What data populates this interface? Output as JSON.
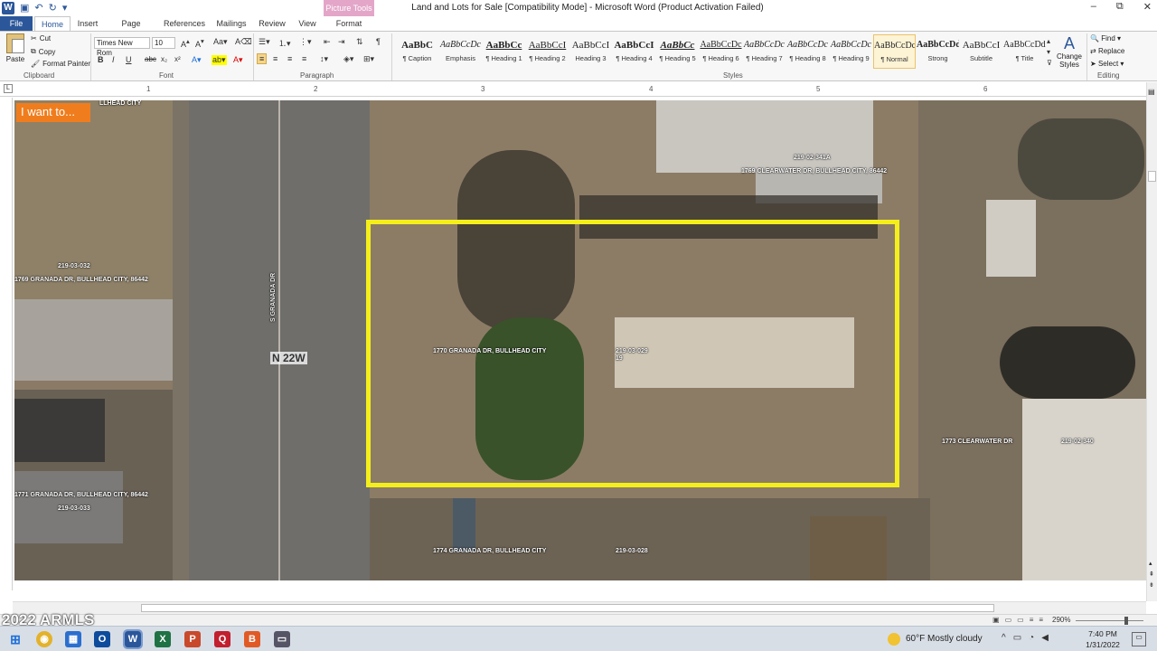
{
  "window": {
    "title": "Land and Lots for Sale [Compatibility Mode] - Microsoft Word (Product Activation Failed)",
    "picture_tools": "Picture Tools",
    "controls": [
      "–",
      "⧉",
      "✕"
    ]
  },
  "tabs": [
    "File",
    "Home",
    "Insert",
    "Page Layout",
    "References",
    "Mailings",
    "Review",
    "View",
    "Format"
  ],
  "clipboard": {
    "paste": "Paste",
    "cut": "Cut",
    "copy": "Copy",
    "format_painter": "Format Painter",
    "label": "Clipboard"
  },
  "font": {
    "name": "Times New Rom",
    "size": "10",
    "label": "Font",
    "buttons": [
      "B",
      "I",
      "U",
      "abc",
      "x₂",
      "x²"
    ]
  },
  "paragraph": {
    "label": "Paragraph"
  },
  "styles": {
    "label": "Styles",
    "items": [
      {
        "sample": "AaBbC",
        "name": "¶ Caption"
      },
      {
        "sample": "AaBbCcDc",
        "name": "Emphasis"
      },
      {
        "sample": "AaBbCc",
        "name": "¶ Heading 1"
      },
      {
        "sample": "AaBbCcI",
        "name": "¶ Heading 2"
      },
      {
        "sample": "AaBbCcI",
        "name": "Heading 3"
      },
      {
        "sample": "AaBbCcI",
        "name": "¶ Heading 4"
      },
      {
        "sample": "AaBbCc",
        "name": "¶ Heading 5"
      },
      {
        "sample": "AaBbCcDc",
        "name": "¶ Heading 6"
      },
      {
        "sample": "AaBbCcDc",
        "name": "¶ Heading 7"
      },
      {
        "sample": "AaBbCcDc",
        "name": "¶ Heading 8"
      },
      {
        "sample": "AaBbCcDc",
        "name": "¶ Heading 9"
      },
      {
        "sample": "AaBbCcDc",
        "name": "¶ Normal"
      },
      {
        "sample": "AaBbCcDd",
        "name": "Strong"
      },
      {
        "sample": "AaBbCcI",
        "name": "Subtitle"
      },
      {
        "sample": "AaBbCcDdI",
        "name": "¶ Title"
      }
    ],
    "change_styles": "Change Styles"
  },
  "editing": {
    "label": "Editing",
    "find": "Find",
    "replace": "Replace",
    "select": "Select"
  },
  "ruler": {
    "marks": [
      "1",
      "2",
      "3",
      "4",
      "5",
      "6"
    ]
  },
  "map": {
    "i_want_to": "I want to...",
    "road_label": "N 22W",
    "street_name": "S GRANADA DR",
    "lot_outline_color": "#f4ef1a",
    "parcels": [
      {
        "text": "219-02-341A"
      },
      {
        "text": "1769 CLEARWATER DR, BULLHEAD CITY, 86442"
      },
      {
        "text": "219-03-032"
      },
      {
        "text": "1769 GRANADA DR, BULLHEAD CITY, 86442"
      },
      {
        "text": "1770 GRANADA DR, BULLHEAD CITY"
      },
      {
        "text": "219-03-029"
      },
      {
        "text": "19"
      },
      {
        "text": "1773 CLEARWATER DR"
      },
      {
        "text": "219-02-340"
      },
      {
        "text": "1771 GRANADA DR, BULLHEAD CITY, 86442"
      },
      {
        "text": "219-03-033"
      },
      {
        "text": "1774 GRANADA DR, BULLHEAD CITY"
      },
      {
        "text": "219-03-028"
      },
      {
        "text": "LLHEAD CITY"
      }
    ]
  },
  "watermark": "2022 ARMLS",
  "status": {
    "zoom": "290%"
  },
  "taskbar": {
    "weather": "60°F  Mostly cloudy",
    "time": "7:40 PM",
    "date": "1/31/2022"
  }
}
